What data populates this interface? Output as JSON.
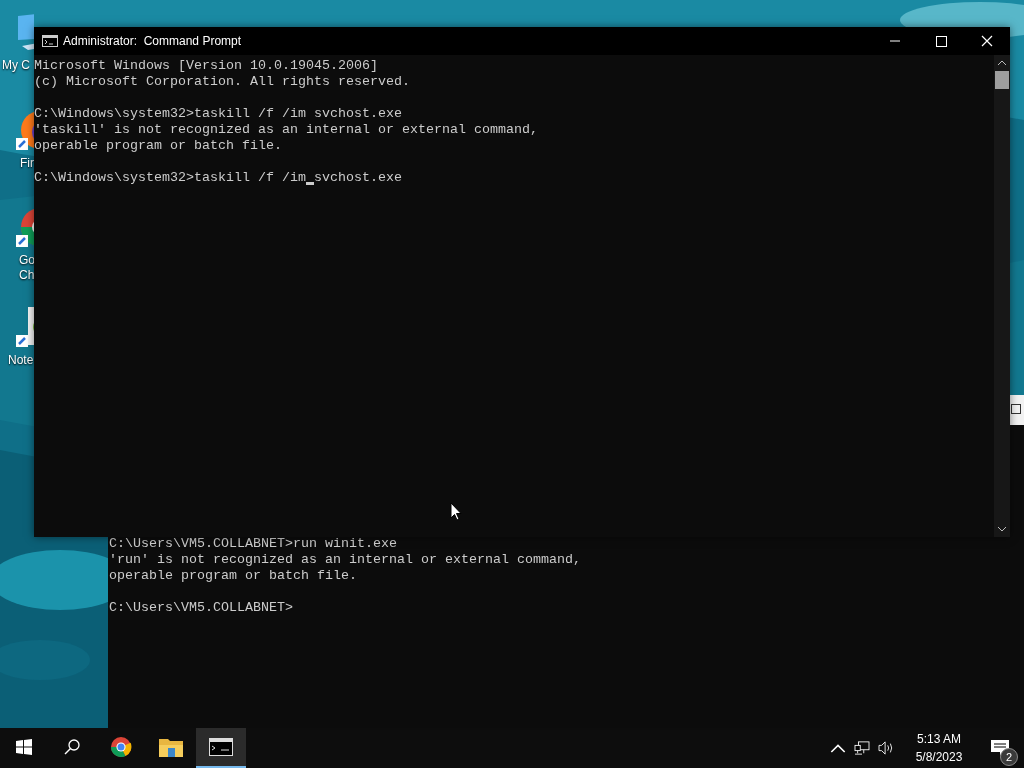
{
  "desktop_icons": [
    {
      "kind": "computer",
      "label_lines": [
        "My C"
      ]
    },
    {
      "kind": "firefox",
      "label_lines": [
        "Fir"
      ]
    },
    {
      "kind": "chrome",
      "label_lines": [
        "Go",
        "Ch"
      ]
    },
    {
      "kind": "notepad",
      "label_lines": [
        "Note"
      ]
    }
  ],
  "background_window": {
    "lines": [
      {
        "kind": "text",
        "text": "C:\\Users\\VM5.COLLABNET>run winit.exe"
      },
      {
        "kind": "text",
        "text": "'run' is not recognized as an internal or external command,"
      },
      {
        "kind": "text",
        "text": "operable program or batch file."
      },
      {
        "kind": "blank"
      },
      {
        "kind": "text",
        "text": "C:\\Users\\VM5.COLLABNET>"
      }
    ]
  },
  "window": {
    "title": "Administrator:  Command Prompt",
    "lines": [
      {
        "kind": "text",
        "text": "Microsoft Windows [Version 10.0.19045.2006]"
      },
      {
        "kind": "text",
        "text": "(c) Microsoft Corporation. All rights reserved."
      },
      {
        "kind": "blank"
      },
      {
        "kind": "text",
        "text": "C:\\Windows\\system32>taskill /f /im svchost.exe"
      },
      {
        "kind": "text",
        "text": "'taskill' is not recognized as an internal or external command,"
      },
      {
        "kind": "text",
        "text": "operable program or batch file."
      },
      {
        "kind": "blank"
      },
      {
        "kind": "input",
        "text_before_cursor": "C:\\Windows\\system32>taskill /f /im",
        "text_after_cursor": " svchost.exe"
      }
    ]
  },
  "taskbar": {
    "apps": [
      {
        "kind": "start",
        "selected": false
      },
      {
        "kind": "search",
        "selected": false
      },
      {
        "kind": "chrome",
        "selected": false
      },
      {
        "kind": "explorer",
        "selected": false
      },
      {
        "kind": "terminal",
        "selected": true
      }
    ],
    "time": "5:13 AM",
    "date": "5/8/2023",
    "notification_count": "2"
  }
}
